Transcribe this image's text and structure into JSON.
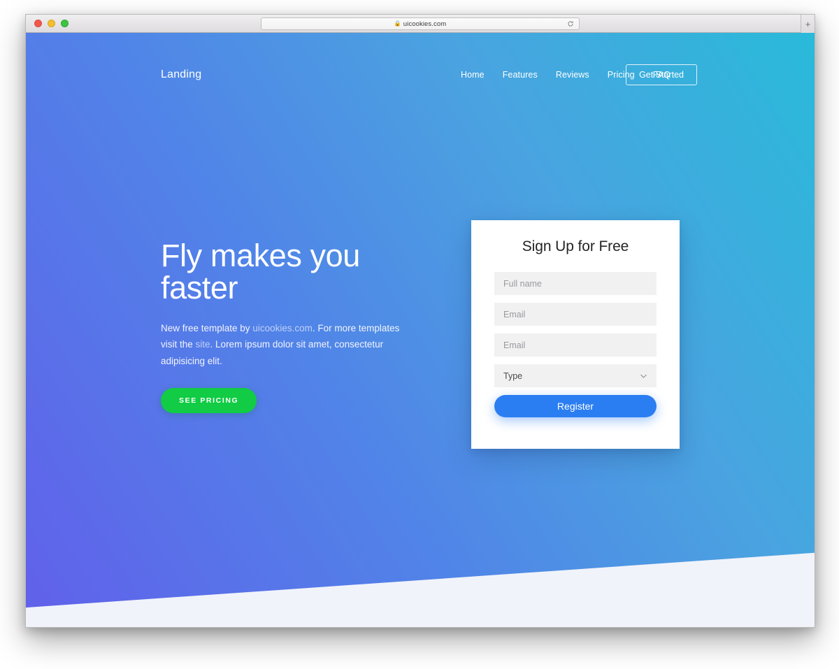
{
  "browser": {
    "url": "uicookies.com",
    "lock_icon": "lock-icon",
    "reload_icon": "reload-icon",
    "new_tab_label": "+",
    "traffic_lights": [
      "close",
      "minimize",
      "maximize"
    ],
    "colors": {
      "close": "#f2574b",
      "minimize": "#f6bd31",
      "maximize": "#3ec341"
    }
  },
  "nav": {
    "brand": "Landing",
    "links": [
      {
        "label": "Home"
      },
      {
        "label": "Features"
      },
      {
        "label": "Reviews"
      },
      {
        "label": "Pricing"
      },
      {
        "label": "FAQ"
      }
    ],
    "cta_label": "Get Started"
  },
  "hero": {
    "title": "Fly makes you faster",
    "paragraph": {
      "part1": "New free template by ",
      "link1": "uicookies.com",
      "part2": ". For more templates visit the ",
      "link2": "site",
      "part3": ". Lorem ipsum dolor sit amet, consectetur adipisicing elit."
    },
    "cta_label": "See Pricing",
    "gradient_from": "#6160ea",
    "gradient_to": "#29bada",
    "cta_color": "#11cc44"
  },
  "signup": {
    "title": "Sign Up for Free",
    "fields": [
      {
        "name": "full-name",
        "placeholder": "Full name",
        "value": ""
      },
      {
        "name": "email",
        "placeholder": "Email",
        "value": ""
      },
      {
        "name": "email-confirm",
        "placeholder": "Email",
        "value": ""
      }
    ],
    "select": {
      "label": "Type",
      "icon": "chevron-down-icon",
      "options": [
        "Type"
      ]
    },
    "submit_label": "Register",
    "submit_color": "#2b7ef2"
  },
  "footer_section": {
    "background": "#f0f3fa"
  }
}
